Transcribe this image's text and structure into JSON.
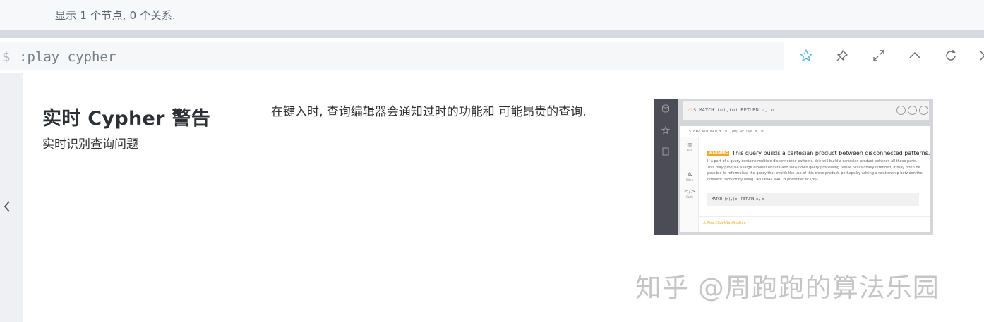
{
  "status": {
    "text": "显示 1 个节点, 0 个关系."
  },
  "command": {
    "prompt": "$",
    "text": ":play cypher"
  },
  "toolbar": {
    "icons": [
      "star-icon",
      "pin-icon",
      "expand-icon",
      "collapse-icon",
      "rerun-icon",
      "close-icon"
    ]
  },
  "slide": {
    "title": "实时 Cypher 警告",
    "subtitle": "实时识别查询问题",
    "description": "在键入时, 查询编辑器会通知过时的功能和 可能昂贵的查询."
  },
  "preview": {
    "editor_text": "$ MATCH (n),(m) RETURN n, m",
    "frame_title": "$ EXPLAIN MATCH (n),(m) RETURN n, m",
    "tabs": [
      "Plan",
      "Warn",
      "Code"
    ],
    "badge": "WARNING",
    "headline": "This query builds a cartesian product between disconnected patterns.",
    "body": "If a part of a query contains multiple disconnected patterns, this will build a cartesian product between all those parts. This may produce a large amount of data and slow down query processing. While occasionally intended, it may often be possible to reformulate the query that avoids the use of this cross product, perhaps by adding a relationship between the different parts or by using OPTIONAL MATCH (identifier is: (m))",
    "code": "MATCH (n),(m) RETURN n, m",
    "footer": "Neo.ClientNotification"
  },
  "watermark": "知乎 @周跑跑的算法乐园",
  "colors": {
    "accent": "#5bb5e6",
    "warning": "#f5a623"
  }
}
